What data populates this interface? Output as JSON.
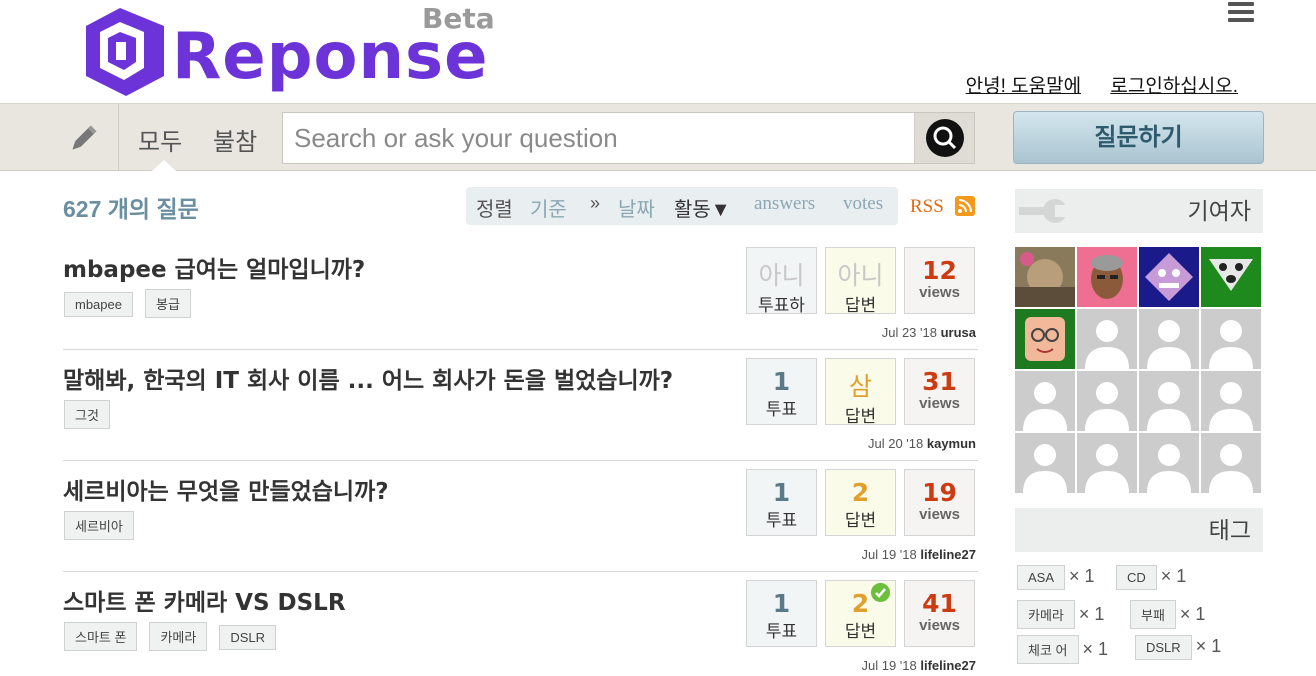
{
  "brand": {
    "name": "Reponse",
    "badge": "Beta",
    "color": "#6c34d8"
  },
  "header": {
    "links": [
      "안녕! 도움말에",
      "로그인하십시오."
    ],
    "menu_icon": "hamburger-icon"
  },
  "nav": {
    "tabs": [
      "모두",
      "불참"
    ],
    "search_placeholder": "Search or ask your question",
    "ask_button": "질문하기"
  },
  "list": {
    "count_label": "627 개의 질문",
    "sort": {
      "label": "정렬",
      "by": "기준",
      "sep": "»",
      "date": "날짜",
      "activity": "활동▼",
      "answers": "answers",
      "votes": "votes"
    },
    "rss": "RSS"
  },
  "questions": [
    {
      "title": "mbapee 급여는 얼마입니까?",
      "tags": [
        "mbapee",
        "봉급"
      ],
      "votes": "아니",
      "votes_label": "투표하",
      "answers": "아니",
      "answers_label": "답변",
      "views": "12",
      "views_label": "views",
      "date": "Jul 23 '18",
      "user": "urusa"
    },
    {
      "title": "말해봐, 한국의 IT 회사 이름 ... 어느 회사가 돈을 벌었습니까?",
      "tags": [
        "그것"
      ],
      "votes": "1",
      "votes_label": "투표",
      "answers": "삼",
      "answers_label": "답변",
      "views": "31",
      "views_label": "views",
      "date": "Jul 20 '18",
      "user": "kaymun"
    },
    {
      "title": "세르비아는 무엇을 만들었습니까?",
      "tags": [
        "세르비아"
      ],
      "votes": "1",
      "votes_label": "투표",
      "answers": "2",
      "answers_label": "답변",
      "views": "19",
      "views_label": "views",
      "date": "Jul 19 '18",
      "user": "lifeline27"
    },
    {
      "title": "스마트 폰 카메라 VS DSLR",
      "tags": [
        "스마트 폰",
        "카메라",
        "DSLR"
      ],
      "votes": "1",
      "votes_label": "투표",
      "answers": "2",
      "answers_label": "답변",
      "views": "41",
      "views_label": "views",
      "date": "Jul 19 '18",
      "user": "lifeline27",
      "accepted": true
    }
  ],
  "sidebar": {
    "contributors_title": "기여자",
    "tags_title": "태그",
    "tags": [
      {
        "name": "ASA",
        "count": "× 1"
      },
      {
        "name": "CD",
        "count": "× 1"
      },
      {
        "name": "카메라",
        "count": "× 1"
      },
      {
        "name": "부패",
        "count": "× 1"
      },
      {
        "name": "체코 어",
        "count": "× 1"
      },
      {
        "name": "DSLR",
        "count": "× 1"
      }
    ]
  }
}
